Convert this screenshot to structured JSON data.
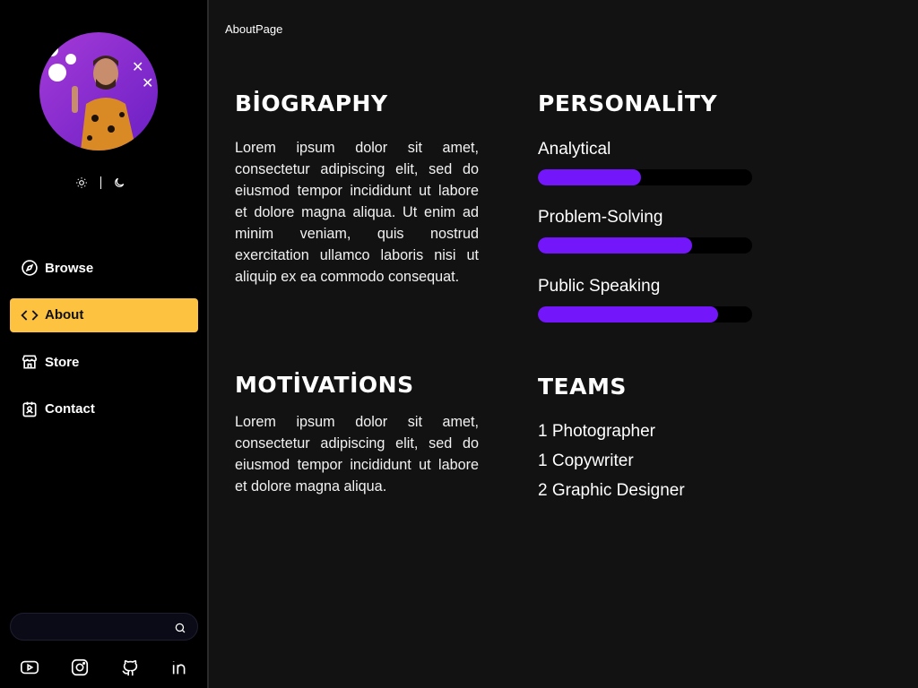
{
  "sidebar": {
    "nav": [
      {
        "label": "Browse",
        "icon": "compass-icon"
      },
      {
        "label": "About",
        "icon": "code-icon",
        "active": true
      },
      {
        "label": "Store",
        "icon": "store-icon"
      },
      {
        "label": "Contact",
        "icon": "contact-icon"
      }
    ],
    "search": {
      "placeholder": ""
    },
    "socials": [
      "youtube-icon",
      "instagram-icon",
      "github-icon",
      "linkedin-icon"
    ],
    "theme_icons": [
      "sun-icon",
      "moon-icon"
    ]
  },
  "main": {
    "page_title": "AboutPage",
    "biography": {
      "title": "BİOGRAPHY",
      "text": "Lorem ipsum dolor sit amet, consectetur adipiscing elit, sed do eiusmod tempor incididunt ut labore et dolore magna aliqua. Ut enim ad minim veniam, quis nostrud exercitation ullamco laboris nisi ut aliquip ex ea commodo consequat."
    },
    "motivations": {
      "title": "MOTİVATİONS",
      "text": "Lorem ipsum dolor sit amet, consectetur adipiscing elit, sed do eiusmod tempor incididunt ut labore et dolore magna aliqua."
    },
    "personality": {
      "title": "PERSONALİTY",
      "skills": [
        {
          "label": "Analytical",
          "value": 0.48
        },
        {
          "label": "Problem-Solving",
          "value": 0.72
        },
        {
          "label": "Public Speaking",
          "value": 0.84
        }
      ]
    },
    "teams": {
      "title": "TEAMS",
      "items": [
        "1 Photographer",
        "1 Copywriter",
        "2 Graphic Designer"
      ]
    }
  },
  "colors": {
    "accent": "#fcc240",
    "bar": "#7317fa",
    "sidebar_bg": "#000000",
    "main_bg": "#121212"
  }
}
